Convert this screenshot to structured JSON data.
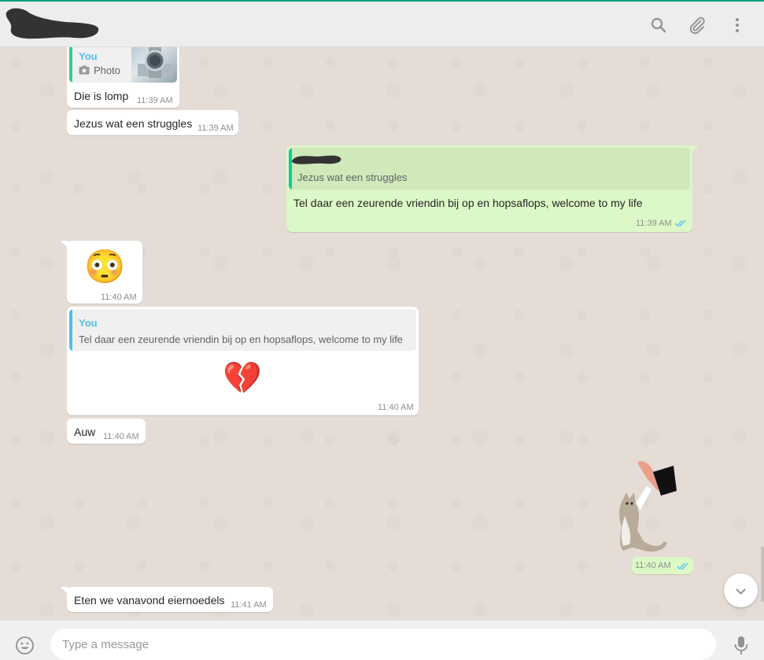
{
  "colors": {
    "header_bg": "#ededed",
    "chat_bg": "#e5ddd5",
    "incoming_bubble": "#ffffff",
    "outgoing_bubble": "#dcf8c6",
    "quote_bar_you": "#35cd96",
    "quote_bar_other": "#06cf9c",
    "tick_color": "#4fc3f7",
    "timestamp": "#8f8f8f"
  },
  "header": {
    "contact_name": "",
    "icons": [
      "search-icon",
      "attach-icon",
      "menu-icon"
    ]
  },
  "messages": [
    {
      "direction": "in",
      "quote_author": "You",
      "quote_label": "Photo",
      "text": "Die is lomp",
      "time": "11:39 AM"
    },
    {
      "direction": "in",
      "text": "Jezus wat een struggles",
      "time": "11:39 AM"
    },
    {
      "direction": "out",
      "quote_text": "Jezus wat een struggles",
      "text": "Tel daar een zeurende vriendin bij op en hopsaflops, welcome to my life",
      "time": "11:39 AM"
    },
    {
      "direction": "in",
      "emoji": "😳",
      "time": "11:40 AM"
    },
    {
      "direction": "in",
      "quote_author": "You",
      "quote_text": "Tel daar een zeurende vriendin bij op en hopsaflops, welcome to my life",
      "emoji": "💔",
      "time": "11:40 AM"
    },
    {
      "direction": "in",
      "text": "Auw",
      "time": "11:40 AM"
    },
    {
      "direction": "out",
      "sticker": "cat-high-five-sticker",
      "time": "11:40 AM"
    },
    {
      "direction": "in",
      "text": "Eten we vanavond eiernoedels",
      "time": "11:41 AM"
    }
  ],
  "composer": {
    "placeholder": "Type a message",
    "icons": [
      "emoji-icon",
      "mic-icon"
    ]
  }
}
